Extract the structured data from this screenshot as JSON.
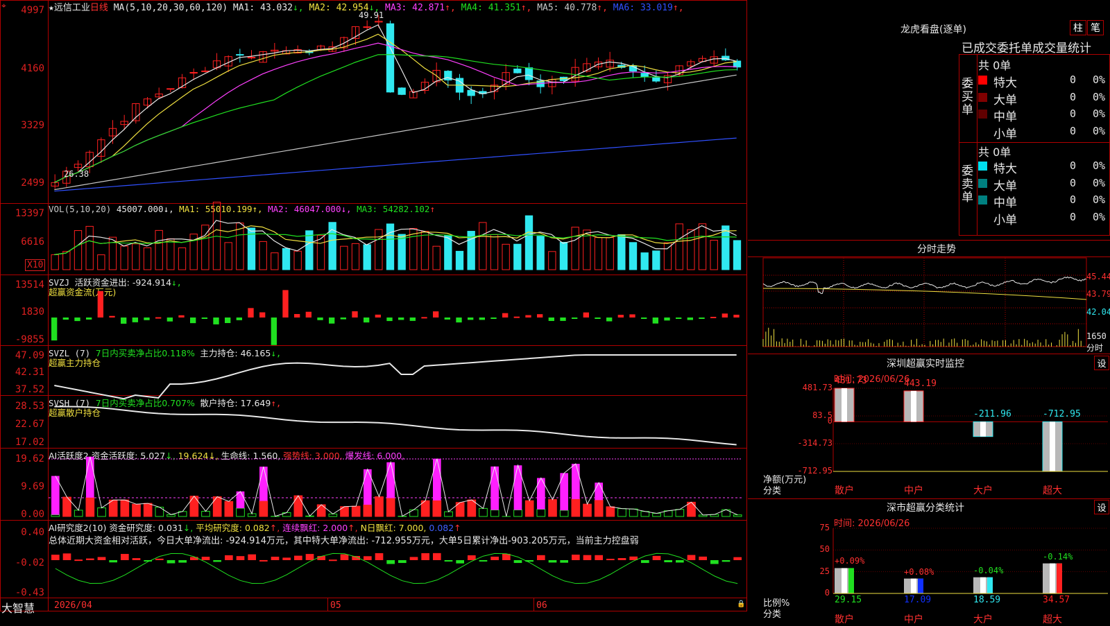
{
  "header": {
    "stock": "远信工业",
    "period": "日线",
    "ma_params": "MA(5,10,20,30,60,120)",
    "ma": [
      {
        "label": "MA1:",
        "value": "43.032",
        "arrow": "↓",
        "color": "#e8e8e8"
      },
      {
        "label": "MA2:",
        "value": "42.954",
        "arrow": "↓",
        "color": "#f0e040"
      },
      {
        "label": "MA3:",
        "value": "42.871",
        "arrow": "↑",
        "color": "#ff40ff"
      },
      {
        "label": "MA4:",
        "value": "41.351",
        "arrow": "↑",
        "color": "#20e020"
      },
      {
        "label": "MA5:",
        "value": "40.778",
        "arrow": "↑",
        "color": "#c8c8c8"
      },
      {
        "label": "MA6:",
        "value": "33.019",
        "arrow": "↑",
        "color": "#3050ff"
      }
    ],
    "high_label": "49.91",
    "low_label": "26.38"
  },
  "price_axis": [
    "4997",
    "4160",
    "3329",
    "2499"
  ],
  "vol": {
    "title": "VOL(5,10,20)",
    "value": "45007.000",
    "ma1": "MA1: 55010.199",
    "ma2": "MA2: 46047.000",
    "ma3": "MA3: 54282.102",
    "axis": [
      "13397",
      "6616"
    ],
    "unit": "X10"
  },
  "svzj": {
    "title": "SVZJ",
    "label": "活跃资金进出: -924.914",
    "arrow": "↓,",
    "subtitle": "超赢资金流(万元)",
    "axis": [
      "13514",
      "1830",
      "-9855"
    ]
  },
  "svzl": {
    "title": "SVZL (7)",
    "label": "7日内买卖净占比0.118%",
    "label2": "主力持仓: 46.165",
    "arrow": "↓,",
    "subtitle": "超赢主力持仓",
    "axis": [
      "47.09",
      "42.31",
      "37.52"
    ]
  },
  "svsh": {
    "title": "SVSH (7)",
    "label": "7日内买卖净占比0.707%",
    "label2": "散户持仓: 17.649",
    "arrow": "↑,",
    "subtitle": "超赢散户持仓",
    "axis": [
      "28.53",
      "22.67",
      "17.02"
    ]
  },
  "ai1": {
    "title": "AI活跃度2",
    "label": "资金活跃度: 5.027",
    "v2": "19.624",
    "v3": "生命线: 1.560,",
    "v4": "强势线: 3.000,",
    "v5": "爆发线: 6.000,",
    "axis": [
      "19.62",
      "9.69",
      "0.00"
    ]
  },
  "ai2": {
    "title": "AI研究度2(10)",
    "label": "资金研究度: 0.031",
    "v2": "平均研究度: 0.082",
    "v3": "连续飘红: 2.000",
    "v4": "N日飘红: 7.000,",
    "v5": "0.082",
    "summary": "总体近期大资金相对活跃，今日大单净流出: -924.914万元，其中特大单净流出: -712.955万元，大单5日累计净出-903.205万元，当前主力控盘弱",
    "axis": [
      "0.40",
      "-0.02",
      "-0.43"
    ]
  },
  "xaxis": {
    "brand": "大智慧",
    "d1": "2026/04",
    "d2": "05",
    "d3": "06"
  },
  "lhb": {
    "title": "龙虎看盘(逐单)",
    "btn1": "柱",
    "btn2": "笔",
    "tabs": "已成交委托单成交量统计",
    "buy_group": "委买单",
    "sell_group": "委卖单",
    "buy_total": "共 0单",
    "sell_total": "共 0单",
    "rows": [
      "特大",
      "大单",
      "中单",
      "小单"
    ],
    "buy_colors": [
      "#ff0000",
      "#800000",
      "#600000",
      "#000000"
    ],
    "sell_colors": [
      "#00e0f0",
      "#008080",
      "#008080",
      "#000000"
    ],
    "count": "0",
    "pct": "0%"
  },
  "fenshi": {
    "title": "分时走势",
    "axis": [
      "45.44",
      "43.79",
      "42.04",
      "1650",
      "分时"
    ]
  },
  "monitor": {
    "title": "深圳超赢实时监控",
    "btn": "设",
    "time": "时间: 2026/06/26",
    "axis": [
      "481.73",
      "83.5",
      "0",
      "-314.73",
      "-712.95"
    ],
    "ylabel": "净额(万元)",
    "xlabel": "分类",
    "cats": [
      "散户",
      "中户",
      "大户",
      "超大"
    ],
    "values": [
      "481.73",
      "443.19",
      "-211.96",
      "-712.95"
    ],
    "nums": [
      481.73,
      443.19,
      -211.96,
      -712.95
    ]
  },
  "stat": {
    "title": "深市超赢分类统计",
    "btn": "设",
    "time": "时间: 2026/06/26",
    "axis": [
      "75",
      "50",
      "25",
      "0"
    ],
    "ylabel": "比例%",
    "xlabel": "分类",
    "cats": [
      "散户",
      "中户",
      "大户",
      "超大"
    ],
    "changes": [
      "+0.09%",
      "+0.08%",
      "-0.04%",
      "-0.14%"
    ],
    "values": [
      "29.15",
      "17.09",
      "18.59",
      "34.57"
    ],
    "nums": [
      29.15,
      17.09,
      18.59,
      34.57
    ],
    "colors": [
      "#20e020",
      "#1030ff",
      "#30e8f0",
      "#ff2020"
    ]
  }
}
